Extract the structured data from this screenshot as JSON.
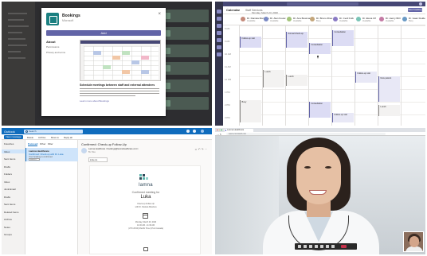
{
  "bookings_modal": {
    "app_name": "Bookings",
    "app_sub": "Microsoft",
    "add_button": "Add",
    "about_label": "About",
    "side_links": [
      "Permissions",
      "Privacy and terms"
    ],
    "desc_title": "Schedule meetings between staff and external attendees",
    "desc_link": "Learn more about Bookings"
  },
  "calendar": {
    "title": "Calendar",
    "tabs": "Staff   Services",
    "date": "Monday, March 23, 2020",
    "new_button": "New booking",
    "staff": [
      {
        "name": "Dr. Daniela Mandera",
        "status": "Available",
        "color": "#c48a7a"
      },
      {
        "name": "Dr. Alan Kovac",
        "status": "Available",
        "color": "#7a8ac4"
      },
      {
        "name": "Dr. Ana Bowman",
        "status": "Available",
        "color": "#a4c47a"
      },
      {
        "name": "Dr. Bruno Zhao",
        "status": "Busy",
        "color": "#c4a67a"
      },
      {
        "name": "Dr. Cecil Folk",
        "status": "Available",
        "color": "#8a7ac4"
      },
      {
        "name": "Dr. Elena Ulf",
        "status": "Available",
        "color": "#7ac4b6"
      },
      {
        "name": "Dr. Henry Brill",
        "status": "Available",
        "color": "#c47aa4"
      },
      {
        "name": "Dr. Isaac Fielder",
        "status": "Busy",
        "color": "#6a9ac4"
      }
    ],
    "times": [
      "8 AM",
      "9 AM",
      "10 AM",
      "11 AM",
      "12 PM",
      "1 PM",
      "2 PM",
      "3 PM"
    ],
    "events": [
      {
        "label": "Follow-up visit",
        "style": "blue"
      },
      {
        "label": "Annual check-up",
        "style": "blue"
      },
      {
        "label": "Consultation",
        "style": "blue"
      },
      {
        "label": "Consultation",
        "style": "blue"
      },
      {
        "label": "Lunch",
        "style": "grey"
      },
      {
        "label": "Lunch",
        "style": "grey"
      },
      {
        "label": "Follow-up visit",
        "style": "light"
      },
      {
        "label": "New patient",
        "style": "light"
      },
      {
        "label": "Busy",
        "style": "grey"
      },
      {
        "label": "Consultation",
        "style": "blue"
      },
      {
        "label": "Lunch",
        "style": "grey"
      },
      {
        "label": "Follow-up visit",
        "style": "light"
      }
    ]
  },
  "outlook": {
    "app_name": "Outlook",
    "search_placeholder": "Search",
    "new_message": "New message",
    "ribbon_actions": [
      "Delete",
      "Archive",
      "Move to",
      "Reply all"
    ],
    "folders": [
      "Favorites",
      "Inbox",
      "Sent Items",
      "Drafts",
      "Folders",
      "Inbox",
      "Junk Email",
      "Drafts",
      "Sent Items",
      "Deleted Items",
      "Archive",
      "Notes",
      "Groups"
    ],
    "list_tabs": [
      "Focused",
      "Other",
      "Filter"
    ],
    "selected_item": {
      "from": "Lamna Healthcare",
      "subject": "Confirmed: Check-up with Dr. Luka",
      "preview": "Your booking is confirmed",
      "attachment": "invite.ics"
    },
    "reading": {
      "subject": "Confirmed: Check-up Follow-Up",
      "from_line": "Lamna Healthcare <bookings@lamnahealthcare.com>",
      "to": "To: You",
      "attachment": "invite.ics",
      "brand": "lamna",
      "confirmed_label": "Confirmed meeting for",
      "name": "Luka",
      "detail_lines": [
        "Check-up Follow-Up",
        "with Dr. Daniela Mandera"
      ],
      "time_lines": [
        "Monday, March 23, 2020",
        "11:00 AM - 11:30 AM",
        "(UTC-08:00) Pacific Time (US & Canada)"
      ]
    }
  },
  "video": {
    "tab_title": "Lamna Healthcare",
    "url": "teams.microsoft.com"
  },
  "colors": {
    "teams_purple": "#6264a7",
    "outlook_blue": "#0f6cbd",
    "hangup_red": "#c4314b"
  }
}
